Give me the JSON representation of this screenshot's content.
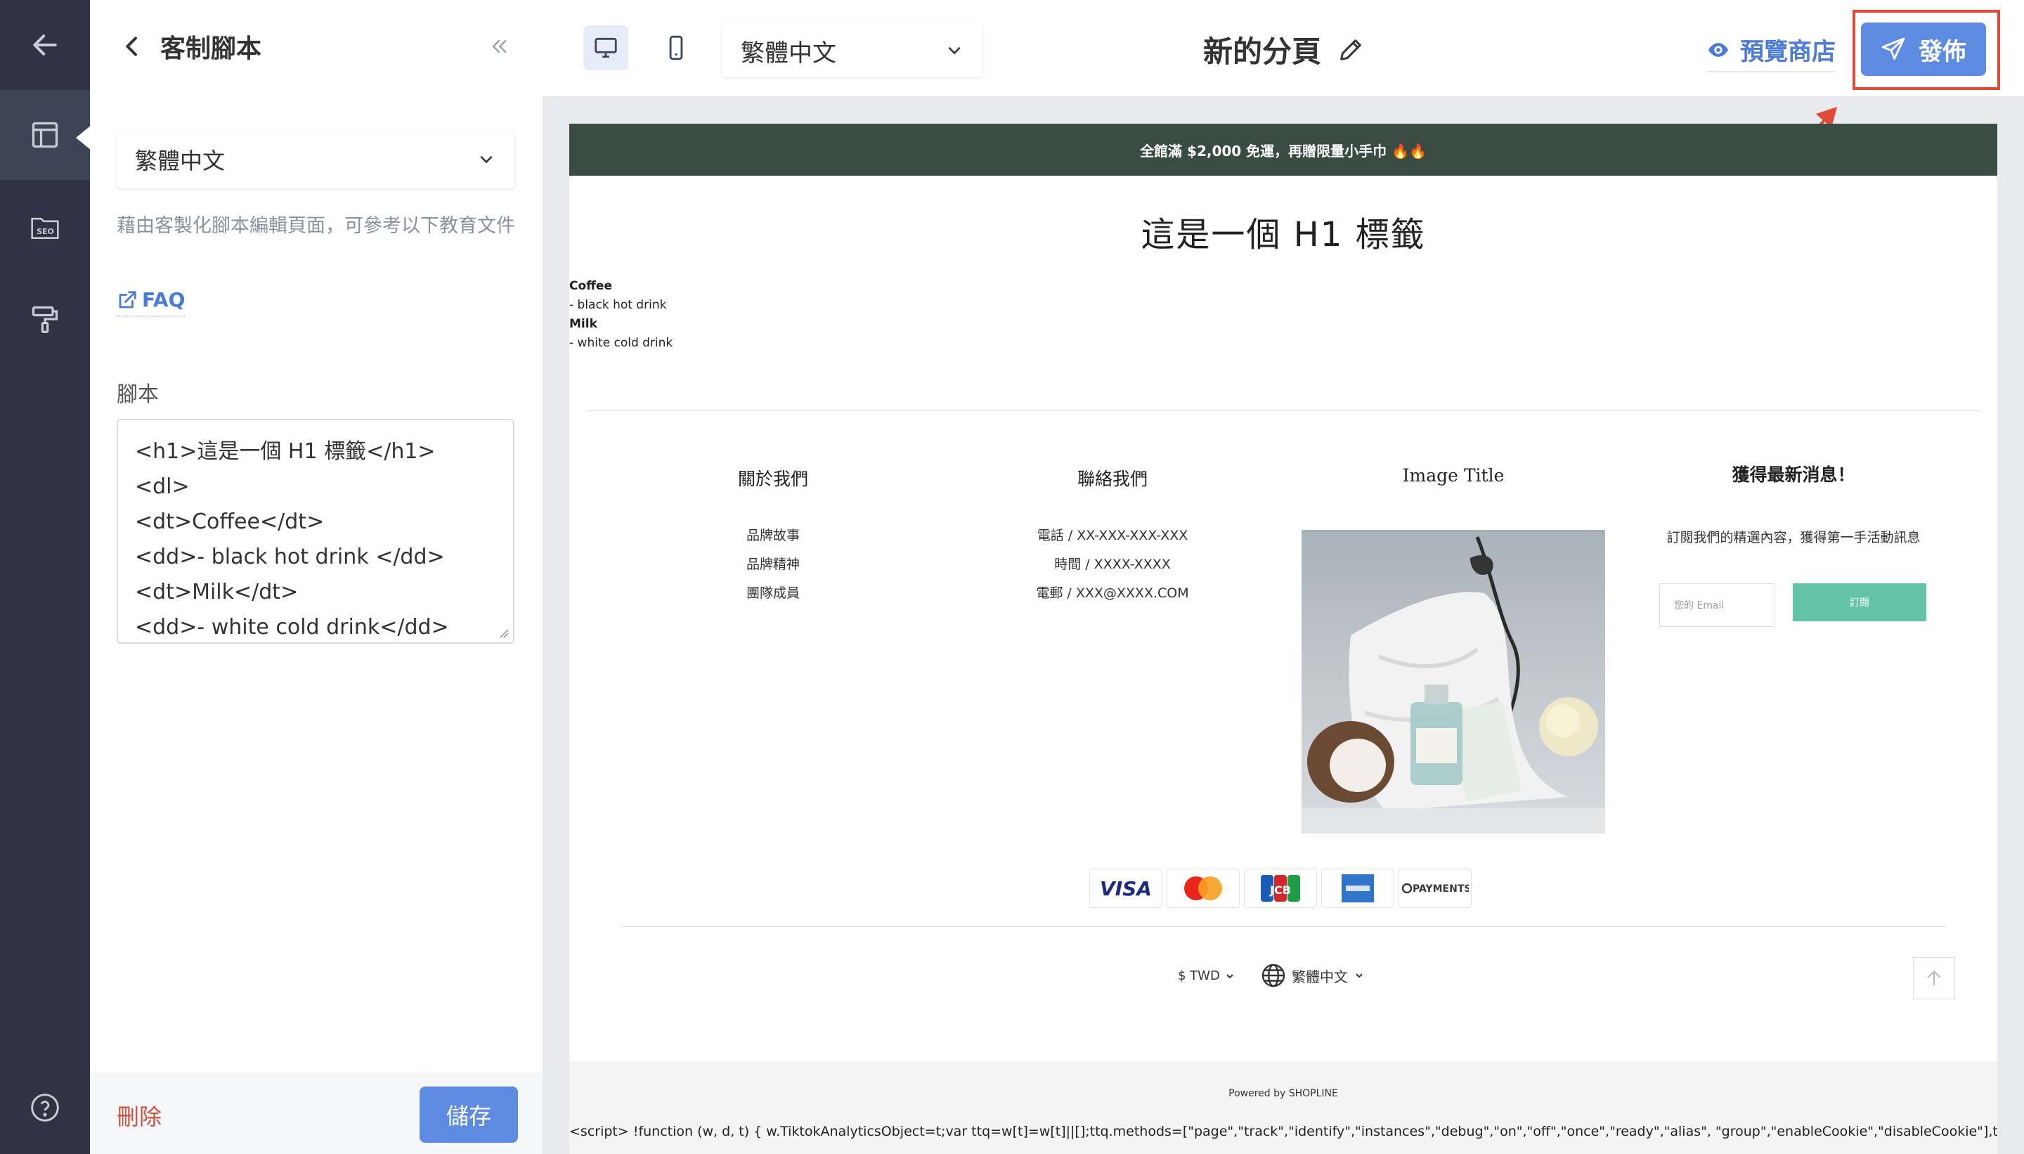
{
  "panel": {
    "title": "客制腳本",
    "language": "繁體中文",
    "hint": "藉由客製化腳本編輯頁面，可參考以下教育文件",
    "faq_label": "FAQ",
    "script_label": "腳本",
    "script_code": "<h1>這是一個 H1 標籤</h1>\n<dl>\n<dt>Coffee</dt>\n<dd>- black hot drink </dd>\n<dt>Milk</dt>\n<dd>- white cold drink</dd>",
    "delete_label": "刪除",
    "save_label": "儲存"
  },
  "topbar": {
    "language": "繁體中文",
    "page_title": "新的分頁",
    "preview_label": "預覽商店",
    "publish_label": "發佈"
  },
  "preview": {
    "promo": "全館滿 $2,000 免運，再贈限量小手巾 🔥🔥",
    "heading": "這是一個 H1 標籤",
    "dl": [
      {
        "term": "Coffee",
        "desc": "- black hot drink"
      },
      {
        "term": "Milk",
        "desc": "- white cold drink"
      }
    ],
    "about": {
      "title": "關於我們",
      "items": [
        "品牌故事",
        "品牌精神",
        "團隊成員"
      ]
    },
    "contact": {
      "title": "聯絡我們",
      "items": [
        "電話 / XX-XXX-XXX-XXX",
        "時間 / XXXX-XXXX",
        "電郵 / XXX@XXXX.COM"
      ]
    },
    "image_title": "Image Title",
    "newsletter": {
      "title": "獲得最新消息！",
      "text": "訂閱我們的精選內容，獲得第一手活動訊息",
      "placeholder": "您的 Email",
      "button": "訂閱"
    },
    "payments": [
      "VISA",
      "Mastercard",
      "JCB",
      "American Express",
      "PAYMENTS"
    ],
    "currency": "$ TWD",
    "locale": "繁體中文",
    "powered": "Powered by SHOPLINE",
    "script_text": "<script> !function (w, d, t) { w.TiktokAnalyticsObject=t;var ttq=w[t]=w[t]||[];ttq.methods=[\"page\",\"track\",\"identify\",\"instances\",\"debug\",\"on\",\"off\",\"once\",\"ready\",\"alias\", \"group\",\"enableCookie\",\"disableCookie\"],ttq.setAndDefer=function(t,e){t[e]=function(){t.push([e].concat(Array.prototype.slice.call(arguments,0)))}};for(var i=0;i<ttq.methods.length;i++)ttq.setAndDefer(ttq,ttq.methods[i]);ttq.instance=function(t){for(var e=ttq._i[t]||"
  },
  "colors": {
    "accent": "#5d8be2",
    "rail": "#2e3443",
    "promo_bar": "#3a4b44",
    "subscribe": "#63c4a8",
    "highlight": "#e04a36"
  }
}
